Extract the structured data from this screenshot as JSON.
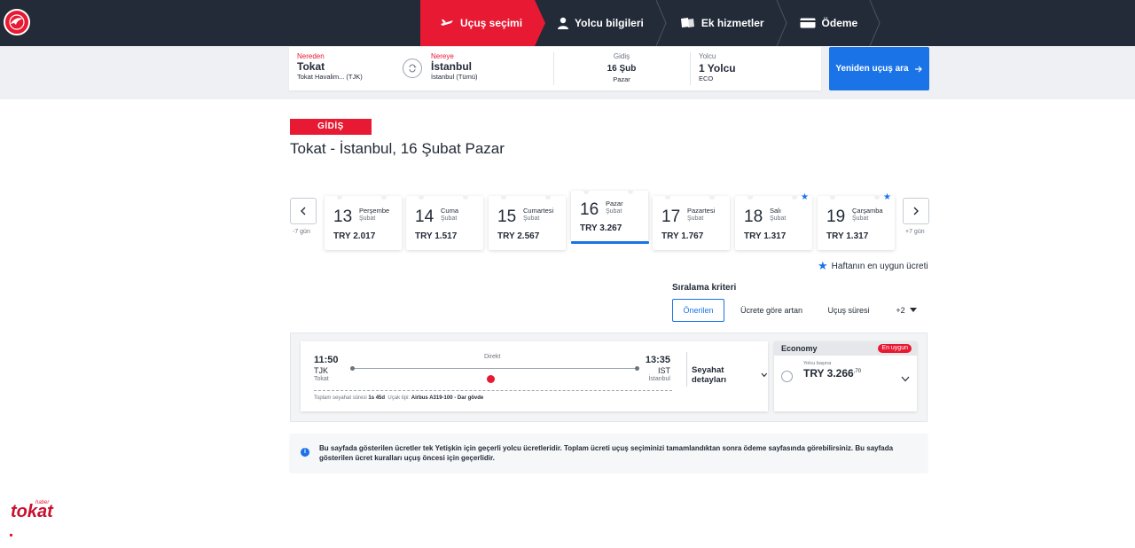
{
  "header": {
    "steps": [
      {
        "label": "Uçuş seçimi",
        "icon": "plane-icon",
        "active": true
      },
      {
        "label": "Yolcu bilgileri",
        "icon": "person-icon",
        "active": false
      },
      {
        "label": "Ek hizmetler",
        "icon": "tickets-icon",
        "active": false
      },
      {
        "label": "Ödeme",
        "icon": "card-icon",
        "active": false
      }
    ],
    "accent": "#e81932",
    "bg": "#232b38"
  },
  "search": {
    "from_label": "Nereden",
    "from_city": "Tokat",
    "from_airport": "Tokat Havalim... (TJK)",
    "to_label": "Nereye",
    "to_city": "İstanbul",
    "to_airport": "İstanbul (Tümü)",
    "date_label": "Gidiş",
    "date_value": "16 Şub",
    "date_day": "Pazar",
    "pax_label": "Yolcu",
    "pax_value": "1 Yolcu",
    "pax_class": "ECO",
    "button": "Yeniden uçuş ara",
    "button_color": "#1b73e8"
  },
  "heading": {
    "badge": "GİDİŞ",
    "route": "Tokat - İstanbul, 16 Şubat Pazar"
  },
  "dates": {
    "prev_label": "-7 gün",
    "next_label": "+7 gün",
    "days": [
      {
        "num": "13",
        "name": "Perşembe",
        "month": "Şubat",
        "price": "TRY 2.017",
        "star": false,
        "selected": false
      },
      {
        "num": "14",
        "name": "Cuma",
        "month": "Şubat",
        "price": "TRY 1.517",
        "star": false,
        "selected": false
      },
      {
        "num": "15",
        "name": "Cumartesi",
        "month": "Şubat",
        "price": "TRY 2.567",
        "star": false,
        "selected": false
      },
      {
        "num": "16",
        "name": "Pazar",
        "month": "Şubat",
        "price": "TRY 3.267",
        "star": false,
        "selected": true
      },
      {
        "num": "17",
        "name": "Pazartesi",
        "month": "Şubat",
        "price": "TRY 1.767",
        "star": false,
        "selected": false
      },
      {
        "num": "18",
        "name": "Salı",
        "month": "Şubat",
        "price": "TRY 1.317",
        "star": true,
        "selected": false
      },
      {
        "num": "19",
        "name": "Çarşamba",
        "month": "Şubat",
        "price": "TRY 1.317",
        "star": true,
        "selected": false
      }
    ],
    "legend": "Haftanın en uygun ücreti"
  },
  "sort": {
    "title": "Sıralama kriteri",
    "options": [
      "Önerilen",
      "Ücrete göre artan",
      "Uçuş süresi",
      "+2"
    ],
    "active": "Önerilen"
  },
  "flight": {
    "dep_time": "11:50",
    "dep_code": "TJK",
    "dep_city": "Tokat",
    "arr_time": "13:35",
    "arr_code": "IST",
    "arr_city": "İstanbul",
    "type": "Direkt",
    "duration_label": "Toplam seyahat süresi",
    "duration": "1s 45d",
    "aircraft_label": "Uçak tipi:",
    "aircraft": "Airbus A319-100 - Dar gövde",
    "details": "Seyahat detayları"
  },
  "fare": {
    "class": "Economy",
    "badge": "En uygun",
    "per": "Yolcu başına",
    "price": "TRY 3.266",
    "cents": ",70"
  },
  "info": {
    "text": "Bu sayfada gösterilen ücretler tek Yetişkin için geçerli yolcu ücretleridir. Toplam ücreti uçuş seçiminizi tamamlandıktan sonra ödeme sayfasında görebilirsiniz. Bu sayfada gösterilen ücret kuralları uçuş öncesi için geçerlidir."
  },
  "watermark": {
    "small": "haber",
    "brand": "tokat"
  }
}
